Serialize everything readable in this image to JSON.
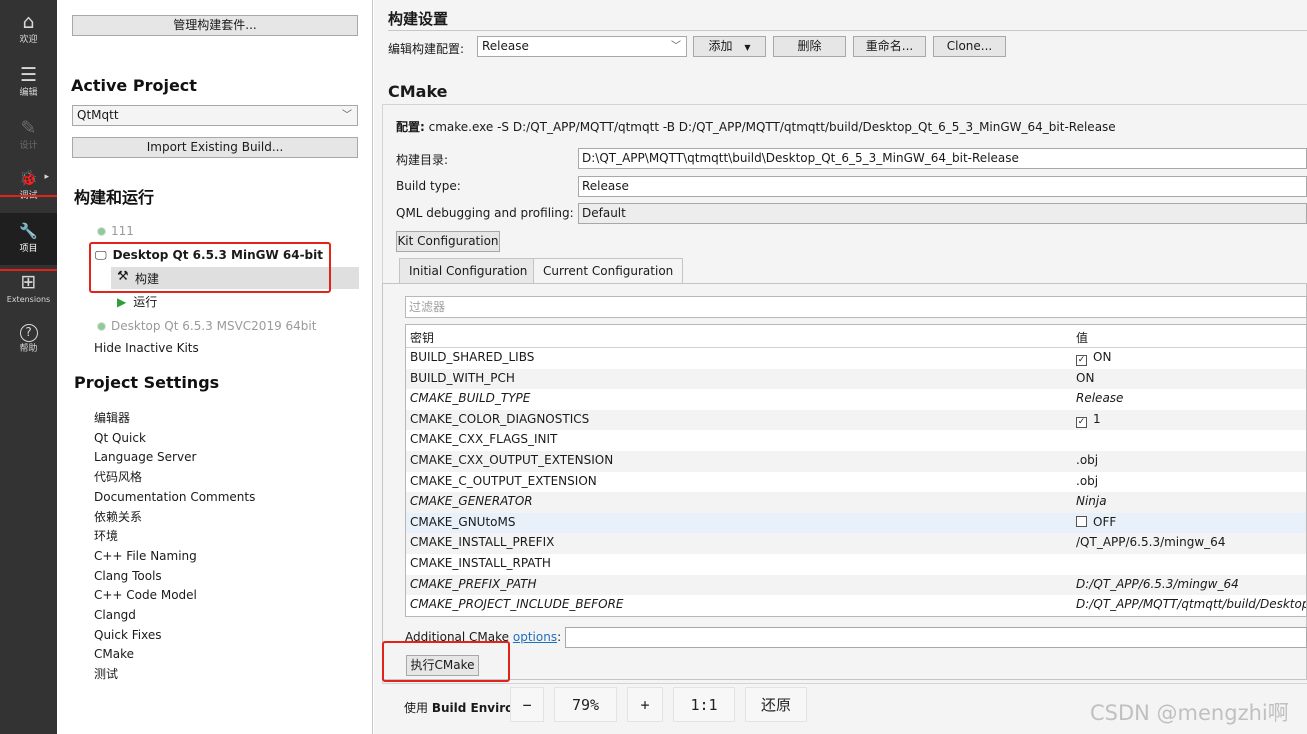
{
  "modes": [
    {
      "icon": "⌂",
      "label": "欢迎"
    },
    {
      "icon": "☰",
      "label": "编辑"
    },
    {
      "icon": "✎",
      "label": "设计"
    },
    {
      "icon": "🐞",
      "label": "调试"
    },
    {
      "icon": "🔧",
      "label": "项目"
    },
    {
      "icon": "⊞",
      "label": "Extensions"
    },
    {
      "icon": "?",
      "label": "帮助"
    }
  ],
  "nav": {
    "manage_kits": "管理构建套件...",
    "active_project_heading": "Active Project",
    "project_name": "QtMqtt",
    "import_build": "Import Existing Build...",
    "build_run_heading": "构建和运行",
    "kits": {
      "kit_111": "111",
      "kit_mingw": "Desktop Qt 6.5.3 MinGW 64-bit",
      "build": "构建",
      "run": "运行",
      "kit_msvc": "Desktop Qt 6.5.3 MSVC2019 64bit",
      "hide_inactive": "Hide Inactive Kits"
    },
    "project_settings_heading": "Project Settings",
    "settings_items": [
      "编辑器",
      "Qt Quick",
      "Language Server",
      "代码风格",
      "Documentation Comments",
      "依赖关系",
      "环境",
      "C++ File Naming",
      "Clang Tools",
      "C++ Code Model",
      "Clangd",
      "Quick Fixes",
      "CMake",
      "测试"
    ]
  },
  "main": {
    "build_settings_title": "构建设置",
    "edit_config_label": "编辑构建配置:",
    "config_value": "Release",
    "add_button": "添加",
    "delete_button": "删除",
    "rename_button": "重命名...",
    "clone_button": "Clone...",
    "cmake_heading": "CMake",
    "config_label": "配置:",
    "config_command": "cmake.exe -S D:/QT_APP/MQTT/qtmqtt -B D:/QT_APP/MQTT/qtmqtt/build/Desktop_Qt_6_5_3_MinGW_64_bit-Release",
    "build_dir_label": "构建目录:",
    "build_dir_value": "D:\\QT_APP\\MQTT\\qtmqtt\\build\\Desktop_Qt_6_5_3_MinGW_64_bit-Release",
    "build_type_label": "Build type:",
    "build_type_value": "Release",
    "qml_label": "QML debugging and profiling:",
    "qml_value": "Default",
    "kit_config_button": "Kit Configuration",
    "tabs": [
      "Initial Configuration",
      "Current Configuration"
    ],
    "filter_placeholder": "过滤器",
    "table_headers": {
      "key": "密钥",
      "value": "值"
    },
    "table_rows": [
      {
        "key": "BUILD_SHARED_LIBS",
        "value": "ON",
        "checkbox": "☑"
      },
      {
        "key": "BUILD_WITH_PCH",
        "value": "ON",
        "checkbox": ""
      },
      {
        "key": "CMAKE_BUILD_TYPE",
        "value": "Release",
        "checkbox": ""
      },
      {
        "key": "CMAKE_COLOR_DIAGNOSTICS",
        "value": "1",
        "checkbox": "☑"
      },
      {
        "key": "CMAKE_CXX_FLAGS_INIT",
        "value": "",
        "checkbox": ""
      },
      {
        "key": "CMAKE_CXX_OUTPUT_EXTENSION",
        "value": ".obj",
        "checkbox": ""
      },
      {
        "key": "CMAKE_C_OUTPUT_EXTENSION",
        "value": ".obj",
        "checkbox": ""
      },
      {
        "key": "CMAKE_GENERATOR",
        "value": "Ninja",
        "checkbox": ""
      },
      {
        "key": "CMAKE_GNUtoMS",
        "value": "OFF",
        "checkbox": "☐"
      },
      {
        "key": "CMAKE_INSTALL_PREFIX",
        "value": "/QT_APP/6.5.3/mingw_64",
        "checkbox": ""
      },
      {
        "key": "CMAKE_INSTALL_RPATH",
        "value": "",
        "checkbox": ""
      },
      {
        "key": "CMAKE_PREFIX_PATH",
        "value": "D:/QT_APP/6.5.3/mingw_64",
        "checkbox": ""
      },
      {
        "key": "CMAKE_PROJECT_INCLUDE_BEFORE",
        "value": "D:/QT_APP/MQTT/qtmqtt/build/Desktop",
        "checkbox": ""
      }
    ],
    "additional_label": "Additional CMake",
    "options_link": "options",
    "run_cmake_button": "执行CMake",
    "use_label": "使用",
    "build_env_label": "Build Environ"
  },
  "zoom": {
    "minus": "−",
    "level": "79%",
    "plus": "+",
    "one_to_one": "1:1",
    "restore": "还原"
  },
  "watermark": "CSDN @mengzhi啊",
  "colors": {
    "mode_bar": "#333333",
    "highlight_red": "#e2231a",
    "kit_green": "#2e9e3a",
    "link_blue": "#1f6fbf"
  }
}
